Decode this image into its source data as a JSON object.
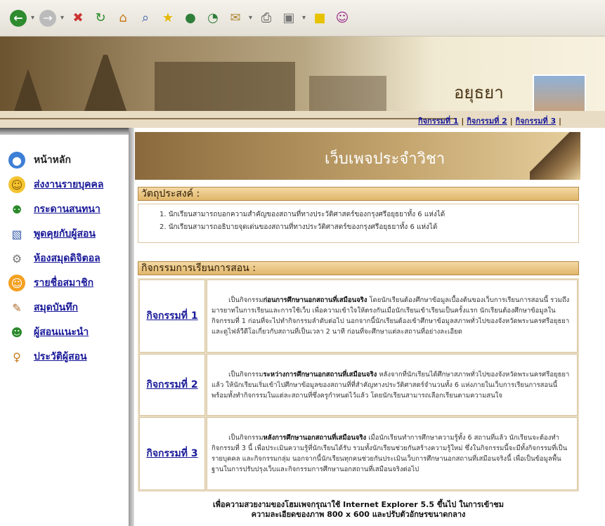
{
  "site": {
    "title": "อยุธยา"
  },
  "activity_links": [
    "กิจกรรมที่ 1",
    "กิจกรรมที่ 2",
    "กิจกรรมที่ 3"
  ],
  "link_sep": "|",
  "sidebar": {
    "items": [
      {
        "label": "หน้าหลัก",
        "icon": "globe-icon"
      },
      {
        "label": "ส่งงานรายบุคคล",
        "icon": "smiley-icon"
      },
      {
        "label": "กระดานสนทนา",
        "icon": "people-icon"
      },
      {
        "label": "พูดคุยกับผู้สอน",
        "icon": "chat-icon"
      },
      {
        "label": "ห้องสมุดดิจิตอล",
        "icon": "library-icon"
      },
      {
        "label": "รายชื่อสมาชิก",
        "icon": "members-icon"
      },
      {
        "label": "สมุดบันทึก",
        "icon": "notebook-icon"
      },
      {
        "label": "ผู้สอนแนะนำ",
        "icon": "teacher-icon"
      },
      {
        "label": "ประวัติผู้สอน",
        "icon": "profile-icon"
      }
    ]
  },
  "header": {
    "title": "เว็บเพจประจำวิชา"
  },
  "objectives": {
    "heading": "วัตถุประสงค์ :",
    "items": [
      "1. นักเรียนสามารถบอกความสำคัญของสถานที่ทางประวัติศาสตร์ของกรุงศรีอยุธยาทั้ง 6 แห่งได้",
      "2. นักเรียนสามารถอธิบายจุดเด่นของสถานที่ทางประวัติศาสตร์ของกรุงศรีอยุธยาทั้ง 6 แห่งได้"
    ]
  },
  "activities": {
    "heading": "กิจกรรมการเรียนการสอน :",
    "rows": [
      {
        "label": "กิจกรรมที่ 1",
        "lead": "เป็นกิจกรรม",
        "bold": "ก่อนการศึกษานอกสถานที่เสมือนจริง",
        "text": " โดยนักเรียนต้องศึกษาข้อมูลเบื้องต้นของเว็บการเรียนการสอนนี้ รวมถึงมารยาทในการเรียนและการใช้เว็บ เพื่อความเข้าใจให้ตรงกันเมื่อนักเรียนเข้าเรียนเป็นครั้งแรก นักเรียนต้องศึกษาข้อมูลในกิจกรรมที่ 1 ก่อนที่จะไปทำกิจกรรมลำดับต่อไป นอกจากนี้นักเรียนต้องเข้าศึกษาข้อมูลสภาพทั่วไปของจังหวัดพระนครศรีอยุธยา และดูไฟล์วีดีโอเกี่ยวกับสถานที่เป็นเวลา 2 นาที ก่อนที่จะศึกษาแต่ละสถานที่อย่างละเอียด"
      },
      {
        "label": "กิจกรรมที่ 2",
        "lead": "เป็นกิจกรรม",
        "bold": "ระหว่างการศึกษานอกสถานที่เสมือนจริง",
        "text": " หลังจากที่นักเรียนได้ศึกษาสภาพทั่วไปของจังหวัดพระนครศรีอยุธยาแล้ว ให้นักเรียนเริ่มเข้าไปศึกษาข้อมูลของสถานที่ที่สำคัญทางประวัติศาสตร์จำนวนทั้ง 6 แห่งภายในเว็บการเรียนการสอนนี้ พร้อมทั้งทำกิจกรรมในแต่ละสถานที่ซึ่งครูกำหนดไว้แล้ว โดยนักเรียนสามารถเลือกเรียนตามความสนใจ"
      },
      {
        "label": "กิจกรรมที่ 3",
        "lead": "เป็นกิจกรรม",
        "bold": "หลังการศึกษานอกสถานที่เสมือนจริง",
        "text": " เมื่อนักเรียนทำการศึกษาความรู้ทั้ง 6 สถานที่แล้ว นักเรียนจะต้องทำกิจกรรมที่ 3 นี้ เพื่อประเมินความรู้ที่นักเรียนได้รับ รวมทั้งนักเรียนช่วยกันสร้างความรู้ใหม่ ซึ่งในกิจกรรมนี้จะมีทั้งกิจกรรมที่เป็นรายบุคคล และกิจกรรมกลุ่ม นอกจากนี้นักเรียนทุกคนช่วยกันประเมินเว็บการศึกษานอกสถานที่เสมือนจริงนี้ เพื่อเป็นข้อมูลพื้นฐานในการปรับปรุงเว็บและกิจกรรมการศึกษานอกสถานที่เสมือนจริงต่อไป"
      }
    ]
  },
  "footer": {
    "line1": "เพื่อความสวยงามของโฮมเพจกรุณาใช้ Internet Explorer 5.5 ขึ้นไป ในการเข้าชม",
    "line2": "ความละเอียดของภาพ 800 x 600 และปรับตัวอักษรขนาดกลาง"
  }
}
